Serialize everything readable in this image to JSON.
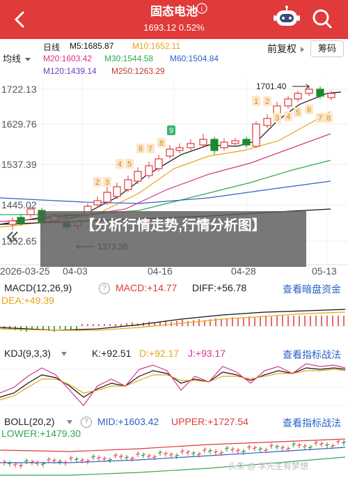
{
  "header": {
    "title": "固态电池",
    "subtitle": "1693.12 0.52%",
    "bg_color": "#e03a3a"
  },
  "ma_bar": {
    "period_label": "日线",
    "type_select": "均线",
    "m5": "M5:1685.87",
    "m10": "M10:1652.11",
    "m20": "M20:1603.42",
    "m30": "M30:1544.58",
    "m60": "M60:1504.84",
    "m120": "M120:1439.14",
    "m250": "M250:1263.29",
    "fq_label": "前复权",
    "chip_label": "筹码"
  },
  "main_chart": {
    "price_ticks": [
      "1722.13",
      "1629.76",
      "1537.39",
      "1445.02",
      "1352.65"
    ],
    "date_ticks": [
      "2026-03-25",
      "04-03",
      "04-16",
      "04-28",
      "05-13"
    ],
    "high_label": "1701.40",
    "low_label": "1373.38",
    "seq_labels": [
      "2",
      "3",
      "4",
      "5",
      "6",
      "7",
      "8",
      "9",
      "1",
      "2",
      "3",
      "4",
      "5",
      "6",
      "7",
      "8"
    ]
  },
  "overlay": {
    "text": "【分析行情走势,行情分析图】"
  },
  "macd": {
    "name": "MACD(12,26,9)",
    "macd_val": "MACD:+14.77",
    "diff_val": "DIFF:+56.78",
    "dea_val": "DEA:+49.39",
    "link": "查看暗盘资金"
  },
  "kdj": {
    "name": "KDJ(9,3,3)",
    "k_val": "K:+92.51",
    "d_val": "D:+92.17",
    "j_val": "J:+93.17",
    "link": "查看指标战法"
  },
  "boll": {
    "name": "BOLL(20,2)",
    "mid_val": "MID:+1603.42",
    "upper_val": "UPPER:+1727.54",
    "lower_val": "LOWER:+1479.30",
    "link": "查看指标战法"
  },
  "watermark": "头条 @ 学先生有梦想",
  "colors": {
    "up": "#e03a3a",
    "down": "#1a8a2a",
    "m5": "#111111",
    "m10": "#e8a317",
    "m20": "#d6338a",
    "m30": "#2fa84f",
    "m60": "#2a63c5",
    "link": "#2a63c5"
  }
}
